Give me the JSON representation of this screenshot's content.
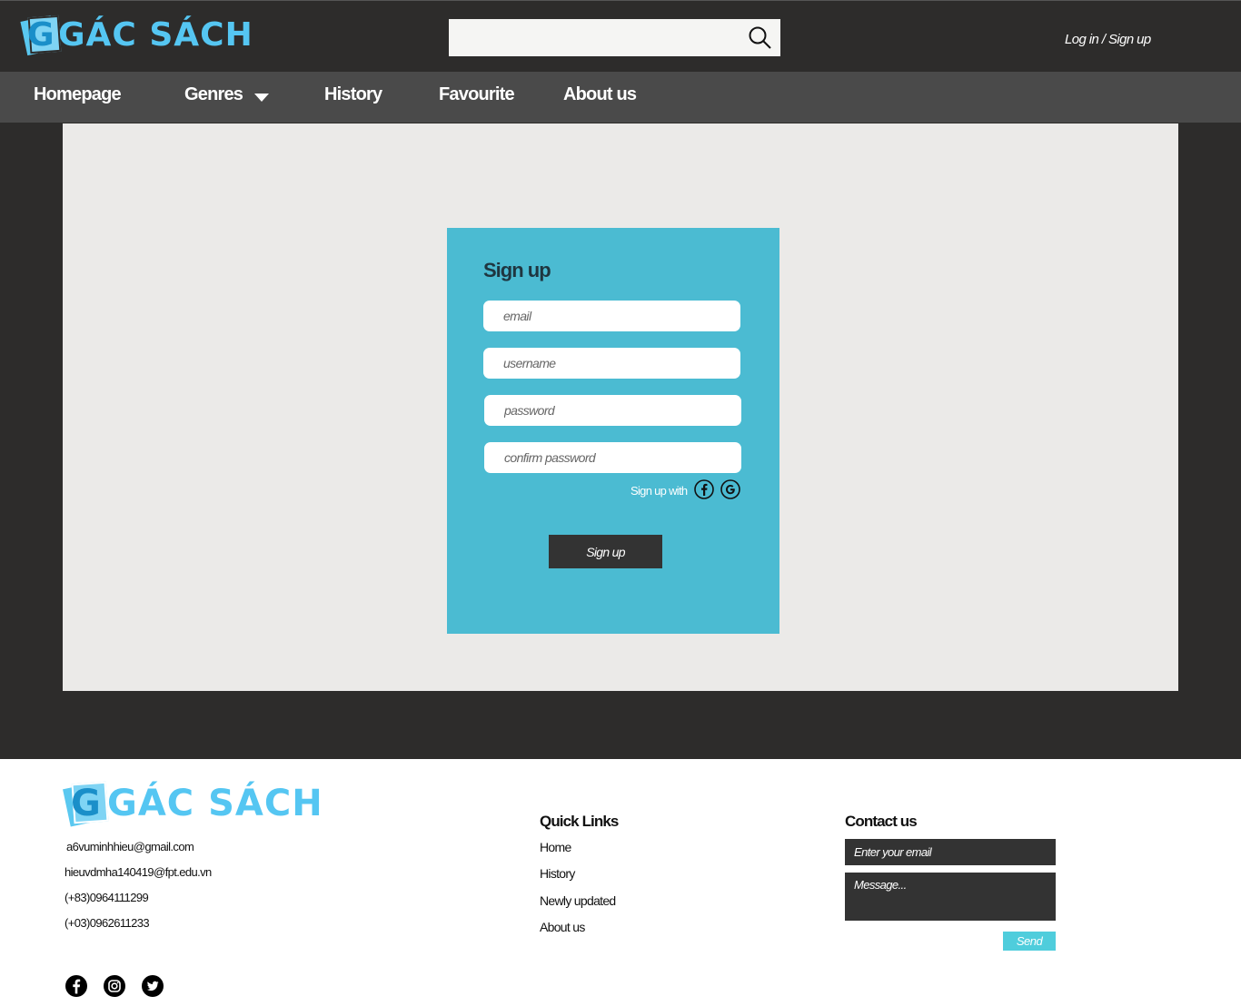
{
  "brand": {
    "logo_text": "GÁC SÁCH",
    "logo_letter": "G",
    "accent": "#55c6f2"
  },
  "header": {
    "search_placeholder": "",
    "auth_link": "Log in / Sign up"
  },
  "nav": {
    "items": [
      "Homepage",
      "Genres",
      "History",
      "Favourite",
      "About us"
    ]
  },
  "signup": {
    "title": "Sign up",
    "email_placeholder": "email",
    "username_placeholder": "username",
    "password_placeholder": "password",
    "confirm_placeholder": "confirm password",
    "signup_with": "Sign up with",
    "button": "Sign up",
    "panel_color": "#4bbbd2"
  },
  "footer": {
    "contacts": [
      "a6vuminhhieu@gmail.com",
      "hieuvdmha140419@fpt.edu.vn",
      "(+83)0964111299",
      "(+03)0962611233"
    ],
    "quick_links_title": "Quick Links",
    "quick_links": [
      "Home",
      "History",
      "Newly updated",
      "About us"
    ],
    "contact_title": "Contact us",
    "email_placeholder": "Enter your email",
    "message_placeholder": "Message...",
    "send": "Send",
    "social_icons": [
      "facebook-icon",
      "instagram-icon",
      "twitter-icon"
    ]
  }
}
